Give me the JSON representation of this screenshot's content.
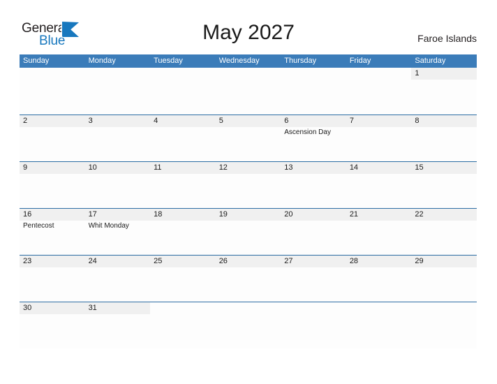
{
  "brand": {
    "word_one": "General",
    "word_two": "Blue",
    "mark_icon": "triangle-logo-icon",
    "color_primary": "#1878be",
    "color_text": "#231f20"
  },
  "header": {
    "title": "May 2027",
    "region": "Faroe Islands"
  },
  "theme": {
    "header_blue": "#3b7cb9",
    "rule_blue": "#2b6ca3",
    "date_band_gray": "#f0f0f0",
    "cell_bg": "#fdfdfd"
  },
  "calendar": {
    "day_names": [
      "Sunday",
      "Monday",
      "Tuesday",
      "Wednesday",
      "Thursday",
      "Friday",
      "Saturday"
    ],
    "weeks": [
      [
        {
          "date": "",
          "event": ""
        },
        {
          "date": "",
          "event": ""
        },
        {
          "date": "",
          "event": ""
        },
        {
          "date": "",
          "event": ""
        },
        {
          "date": "",
          "event": ""
        },
        {
          "date": "",
          "event": ""
        },
        {
          "date": "1",
          "event": ""
        }
      ],
      [
        {
          "date": "2",
          "event": ""
        },
        {
          "date": "3",
          "event": ""
        },
        {
          "date": "4",
          "event": ""
        },
        {
          "date": "5",
          "event": ""
        },
        {
          "date": "6",
          "event": "Ascension Day"
        },
        {
          "date": "7",
          "event": ""
        },
        {
          "date": "8",
          "event": ""
        }
      ],
      [
        {
          "date": "9",
          "event": ""
        },
        {
          "date": "10",
          "event": ""
        },
        {
          "date": "11",
          "event": ""
        },
        {
          "date": "12",
          "event": ""
        },
        {
          "date": "13",
          "event": ""
        },
        {
          "date": "14",
          "event": ""
        },
        {
          "date": "15",
          "event": ""
        }
      ],
      [
        {
          "date": "16",
          "event": "Pentecost"
        },
        {
          "date": "17",
          "event": "Whit Monday"
        },
        {
          "date": "18",
          "event": ""
        },
        {
          "date": "19",
          "event": ""
        },
        {
          "date": "20",
          "event": ""
        },
        {
          "date": "21",
          "event": ""
        },
        {
          "date": "22",
          "event": ""
        }
      ],
      [
        {
          "date": "23",
          "event": ""
        },
        {
          "date": "24",
          "event": ""
        },
        {
          "date": "25",
          "event": ""
        },
        {
          "date": "26",
          "event": ""
        },
        {
          "date": "27",
          "event": ""
        },
        {
          "date": "28",
          "event": ""
        },
        {
          "date": "29",
          "event": ""
        }
      ],
      [
        {
          "date": "30",
          "event": ""
        },
        {
          "date": "31",
          "event": ""
        },
        {
          "date": "",
          "event": ""
        },
        {
          "date": "",
          "event": ""
        },
        {
          "date": "",
          "event": ""
        },
        {
          "date": "",
          "event": ""
        },
        {
          "date": "",
          "event": ""
        }
      ]
    ]
  }
}
